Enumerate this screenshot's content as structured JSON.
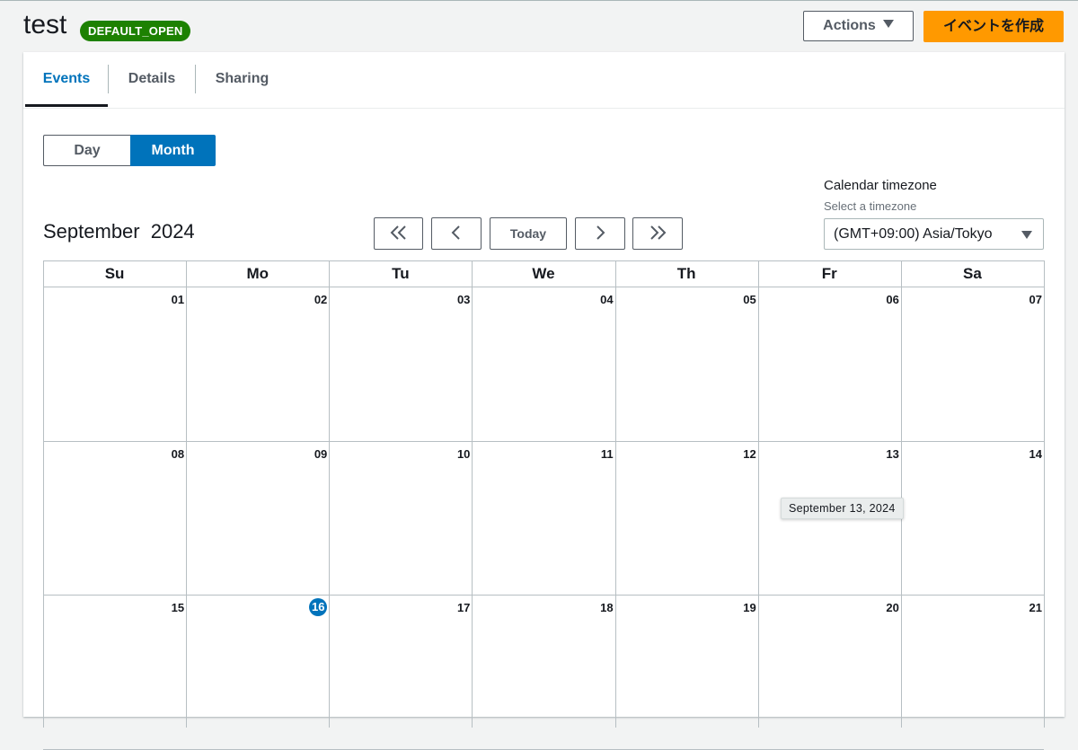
{
  "header": {
    "title": "test",
    "status_badge": "DEFAULT_OPEN",
    "actions_label": "Actions",
    "create_label": "イベントを作成"
  },
  "tabs": [
    {
      "label": "Events",
      "active": true
    },
    {
      "label": "Details",
      "active": false
    },
    {
      "label": "Sharing",
      "active": false
    }
  ],
  "view_toggle": {
    "day_label": "Day",
    "month_label": "Month",
    "selected": "Month"
  },
  "timezone": {
    "label": "Calendar timezone",
    "description": "Select a timezone",
    "value": "(GMT+09:00) Asia/Tokyo"
  },
  "calendar": {
    "month_title": "September  2024",
    "nav": {
      "first_icon": "double-chevron-left-icon",
      "prev_icon": "chevron-left-icon",
      "today_label": "Today",
      "next_icon": "chevron-right-icon",
      "last_icon": "double-chevron-right-icon"
    },
    "weekdays": [
      "Su",
      "Mo",
      "Tu",
      "We",
      "Th",
      "Fr",
      "Sa"
    ],
    "weeks": [
      [
        "01",
        "02",
        "03",
        "04",
        "05",
        "06",
        "07"
      ],
      [
        "08",
        "09",
        "10",
        "11",
        "12",
        "13",
        "14"
      ],
      [
        "15",
        "16",
        "17",
        "18",
        "19",
        "20",
        "21"
      ]
    ],
    "today": "16",
    "hover_tooltip": "September 13, 2024"
  },
  "colors": {
    "accent": "#0073bb",
    "primary_button": "#ff9900",
    "badge_green": "#1d8102"
  }
}
